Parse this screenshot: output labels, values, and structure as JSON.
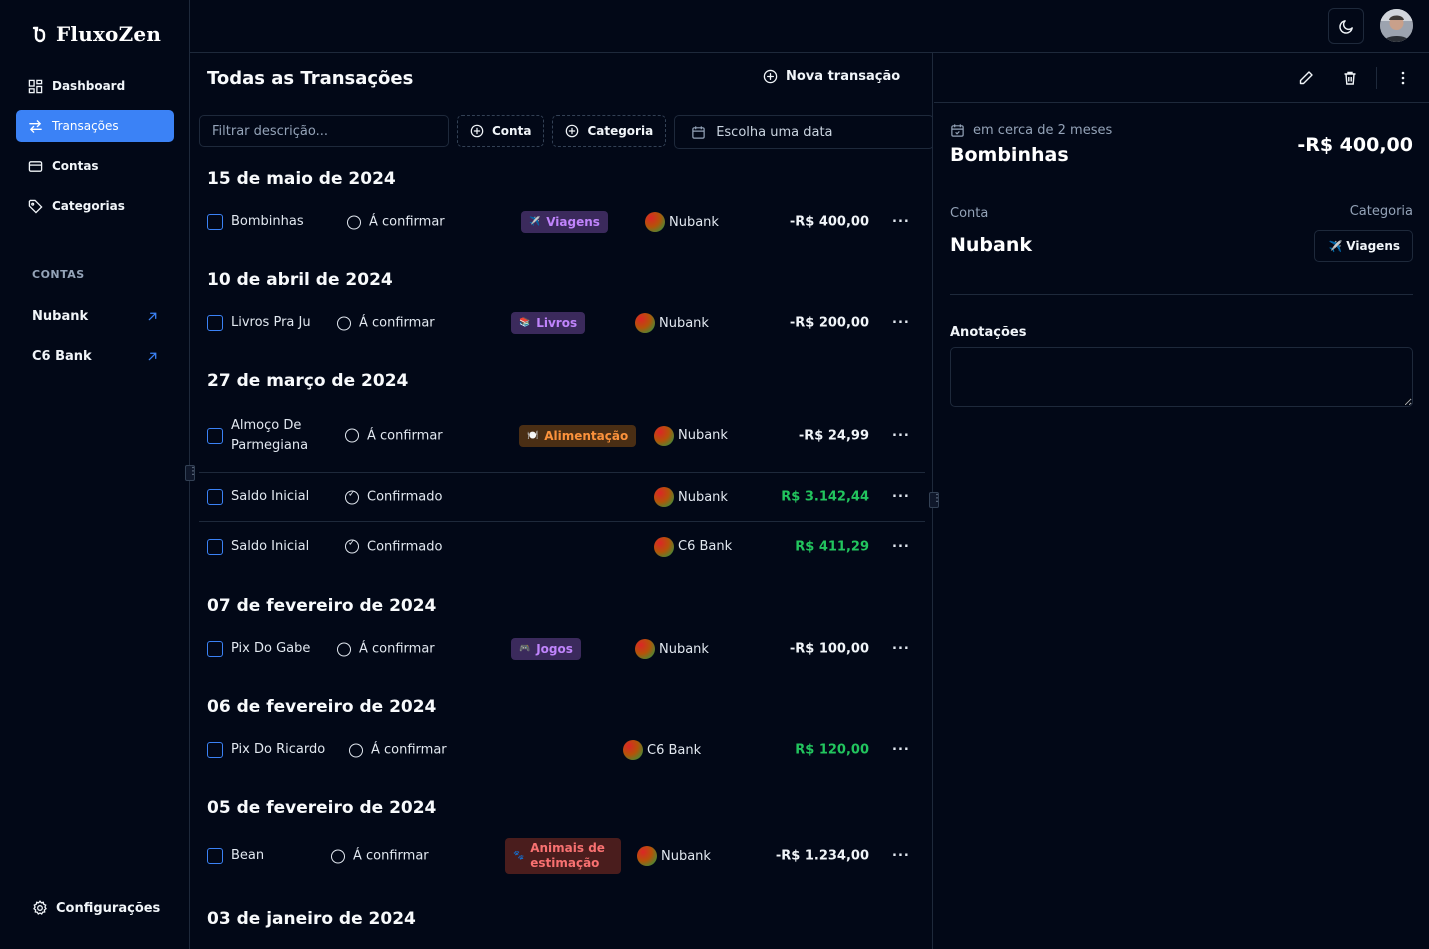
{
  "app": {
    "name": "FluxoZen"
  },
  "sidebar": {
    "nav": [
      {
        "label": "Dashboard",
        "icon": "dashboard-icon"
      },
      {
        "label": "Transações",
        "icon": "transfer-icon",
        "active": true
      },
      {
        "label": "Contas",
        "icon": "wallet-icon"
      },
      {
        "label": "Categorias",
        "icon": "tag-icon"
      }
    ],
    "accounts_section_label": "CONTAS",
    "accounts": [
      {
        "label": "Nubank",
        "icon": "arrow-up-right-icon"
      },
      {
        "label": "C6 Bank",
        "icon": "arrow-up-right-icon"
      }
    ],
    "settings_label": "Configurações"
  },
  "topbar": {
    "theme_icon": "moon-icon",
    "avatar": "user-avatar"
  },
  "main": {
    "title": "Todas as Transações",
    "new_button": "Nova transação",
    "filters": {
      "description_placeholder": "Filtrar descrição...",
      "account_label": "Conta",
      "category_label": "Categoria",
      "date_label": "Escolha uma data"
    },
    "groups": [
      {
        "date": "15 de maio de 2024",
        "items": [
          {
            "description": "Bombinhas",
            "status": "Á confirmar",
            "confirmed": false,
            "category": "Viagens",
            "category_icon": "✈️",
            "bank": "Nubank",
            "amount": "-R$ 400,00",
            "positive": false
          }
        ]
      },
      {
        "date": "10 de abril de 2024",
        "items": [
          {
            "description": "Livros Pra Ju",
            "status": "Á confirmar",
            "confirmed": false,
            "category": "Livros",
            "category_icon": "📚",
            "bank": "Nubank",
            "amount": "-R$ 200,00",
            "positive": false
          }
        ]
      },
      {
        "date": "27 de março de 2024",
        "items": [
          {
            "description": "Almoço De Parmegiana",
            "status": "Á confirmar",
            "confirmed": false,
            "category": "Alimentação",
            "category_icon": "🍽️",
            "bank": "Nubank",
            "amount": "-R$ 24,99",
            "positive": false
          },
          {
            "description": "Saldo Inicial",
            "status": "Confirmado",
            "confirmed": true,
            "category": "",
            "bank": "Nubank",
            "amount": "R$ 3.142,44",
            "positive": true
          },
          {
            "description": "Saldo Inicial",
            "status": "Confirmado",
            "confirmed": true,
            "category": "",
            "bank": "C6 Bank",
            "amount": "R$ 411,29",
            "positive": true
          }
        ]
      },
      {
        "date": "07 de fevereiro de 2024",
        "items": [
          {
            "description": "Pix Do Gabe",
            "status": "Á confirmar",
            "confirmed": false,
            "category": "Jogos",
            "category_icon": "🎮",
            "bank": "Nubank",
            "amount": "-R$ 100,00",
            "positive": false
          }
        ]
      },
      {
        "date": "06 de fevereiro de 2024",
        "items": [
          {
            "description": "Pix Do Ricardo",
            "status": "Á confirmar",
            "confirmed": false,
            "category": "",
            "bank": "C6 Bank",
            "amount": "R$ 120,00",
            "positive": true
          }
        ]
      },
      {
        "date": "05 de fevereiro de 2024",
        "items": [
          {
            "description": "Bean",
            "status": "Á confirmar",
            "confirmed": false,
            "category": "Animais de estimação",
            "category_icon": "🐾",
            "bank": "Nubank",
            "amount": "-R$ 1.234,00",
            "positive": false
          }
        ]
      },
      {
        "date": "03 de janeiro de 2024",
        "items": []
      }
    ]
  },
  "detail": {
    "date_text": "em cerca de 2 meses",
    "title": "Bombinhas",
    "amount": "-R$ 400,00",
    "account_label": "Conta",
    "account": "Nubank",
    "category_label": "Categoria",
    "category": "Viagens",
    "category_icon": "✈️",
    "notes_label": "Anotações"
  },
  "colors": {
    "background": "#020817",
    "accent": "#3b82f6",
    "positive": "#22c55e",
    "border": "#1e293b",
    "badge_viagens": {
      "bg": "#3b2a5c",
      "fg": "#c084fc"
    },
    "badge_livros": {
      "bg": "#3b2a5c",
      "fg": "#c084fc"
    },
    "badge_alimentacao": {
      "bg": "#4a2e14",
      "fg": "#fb923c"
    },
    "badge_jogos": {
      "bg": "#3b2a5c",
      "fg": "#c084fc"
    },
    "badge_animais": {
      "bg": "#4a1d1d",
      "fg": "#f87171"
    }
  }
}
